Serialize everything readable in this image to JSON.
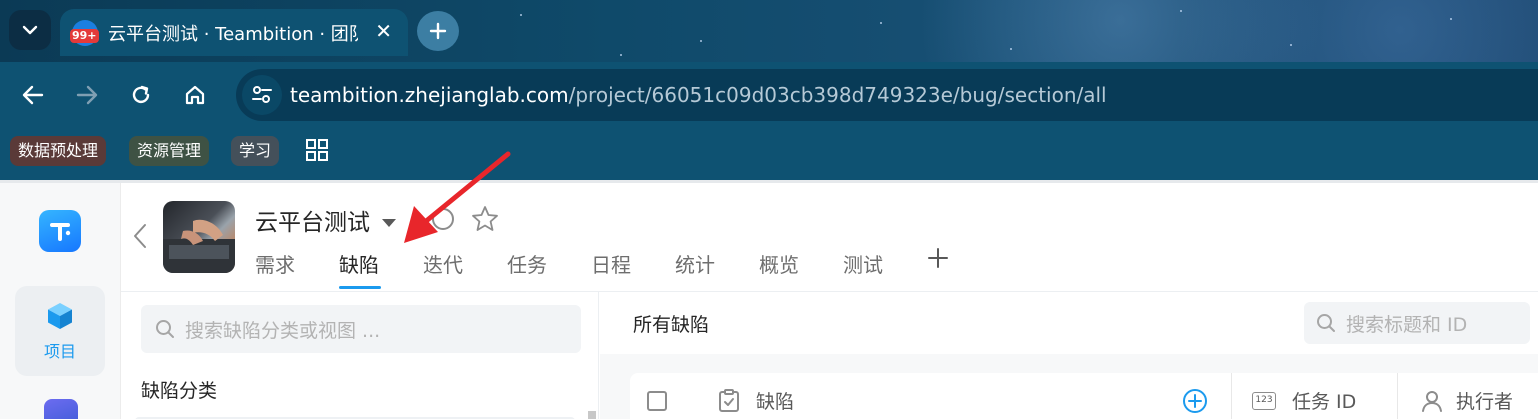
{
  "browser": {
    "tab": {
      "favicon_badge": "99+",
      "title": "云平台测试 · Teambition · 团队",
      "close_glyph": "✕"
    },
    "url": {
      "host": "teambition.zhejianglab.com",
      "path": "/project/66051c09d03cb398d749323e/bug/section/all"
    },
    "bookmarks": [
      {
        "label": "数据预处理"
      },
      {
        "label": "资源管理"
      },
      {
        "label": "学习"
      }
    ],
    "colors": {
      "tab_active": "#0e5272",
      "toolbar": "#0e5272",
      "omnibox": "#083b57"
    }
  },
  "rail": {
    "project_label": "项目"
  },
  "project": {
    "title": "云平台测试",
    "tabs": [
      {
        "label": "需求",
        "active": false
      },
      {
        "label": "缺陷",
        "active": true
      },
      {
        "label": "迭代",
        "active": false
      },
      {
        "label": "任务",
        "active": false
      },
      {
        "label": "日程",
        "active": false
      },
      {
        "label": "统计",
        "active": false
      },
      {
        "label": "概览",
        "active": false
      },
      {
        "label": "测试",
        "active": false
      }
    ],
    "add_tab_glyph": "+"
  },
  "sidebar": {
    "search_placeholder": "搜索缺陷分类或视图 ...",
    "section_title": "缺陷分类"
  },
  "main": {
    "title": "所有缺陷",
    "search_placeholder": "搜索标题和 ID",
    "columns": [
      {
        "label": "缺陷"
      },
      {
        "label": "任务 ID"
      },
      {
        "label": "执行者"
      }
    ],
    "id_icon_text": "123"
  },
  "accent_color": "#1b9aee",
  "annotation_color": "#e8262b"
}
